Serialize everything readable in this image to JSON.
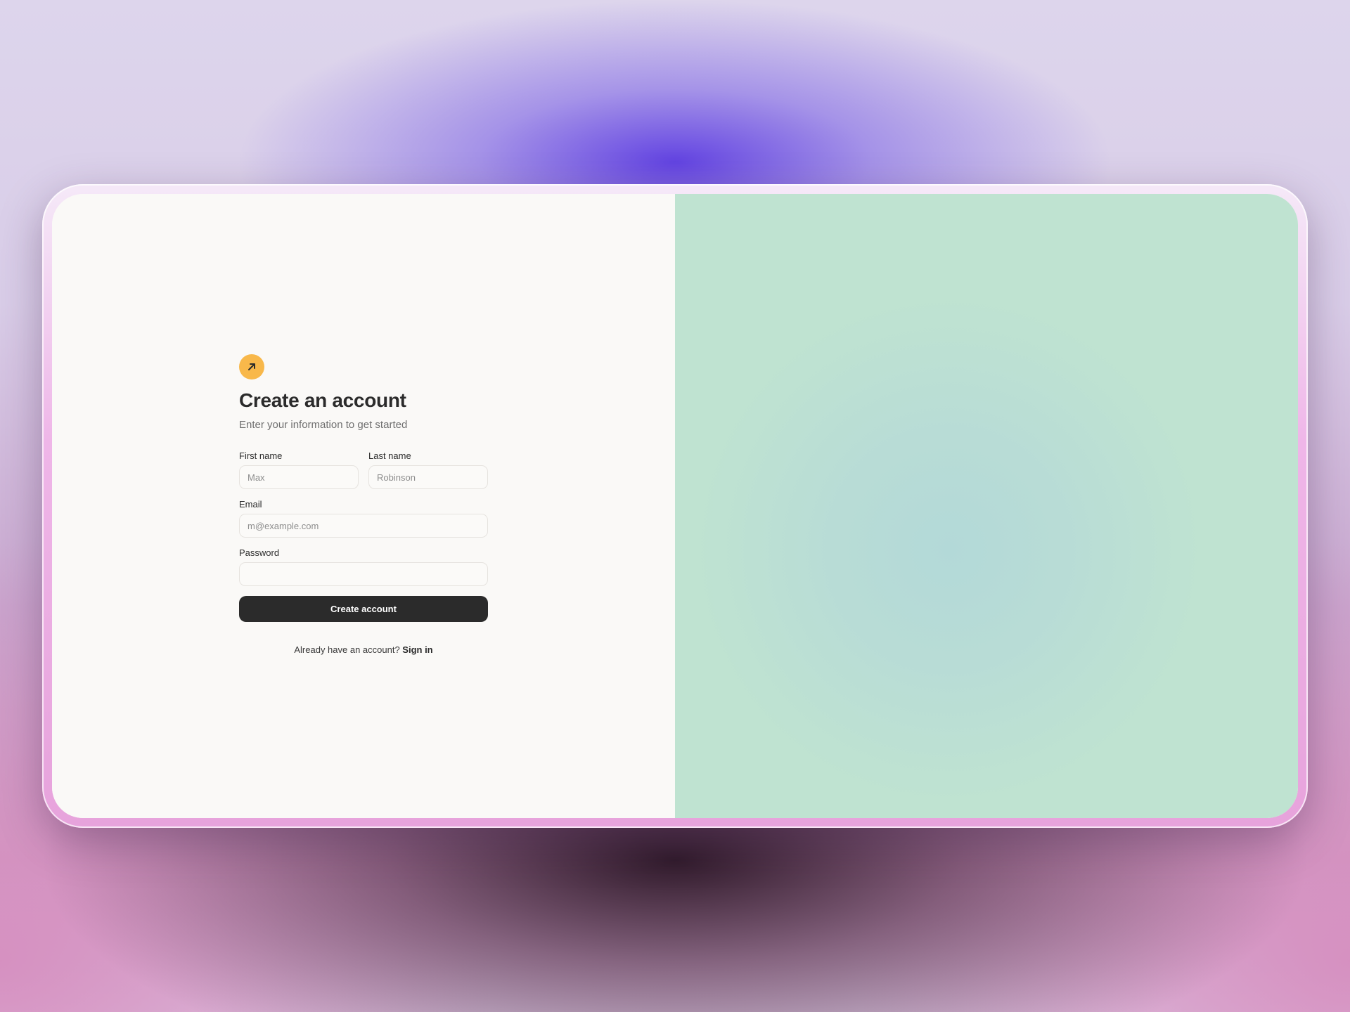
{
  "form": {
    "logo_icon": "arrow-up-right-icon",
    "logo_color": "#f8b84a",
    "title": "Create an account",
    "subtitle": "Enter your information to get started",
    "first_name": {
      "label": "First name",
      "placeholder": "Max",
      "value": ""
    },
    "last_name": {
      "label": "Last name",
      "placeholder": "Robinson",
      "value": ""
    },
    "email": {
      "label": "Email",
      "placeholder": "m@example.com",
      "value": ""
    },
    "password": {
      "label": "Password",
      "placeholder": "",
      "value": ""
    },
    "submit_label": "Create account",
    "footer_text": "Already have an account? ",
    "signin_label": "Sign in"
  },
  "colors": {
    "left_panel": "#faf9f7",
    "right_panel": "#bfe3d1",
    "button": "#2b2b2b"
  }
}
